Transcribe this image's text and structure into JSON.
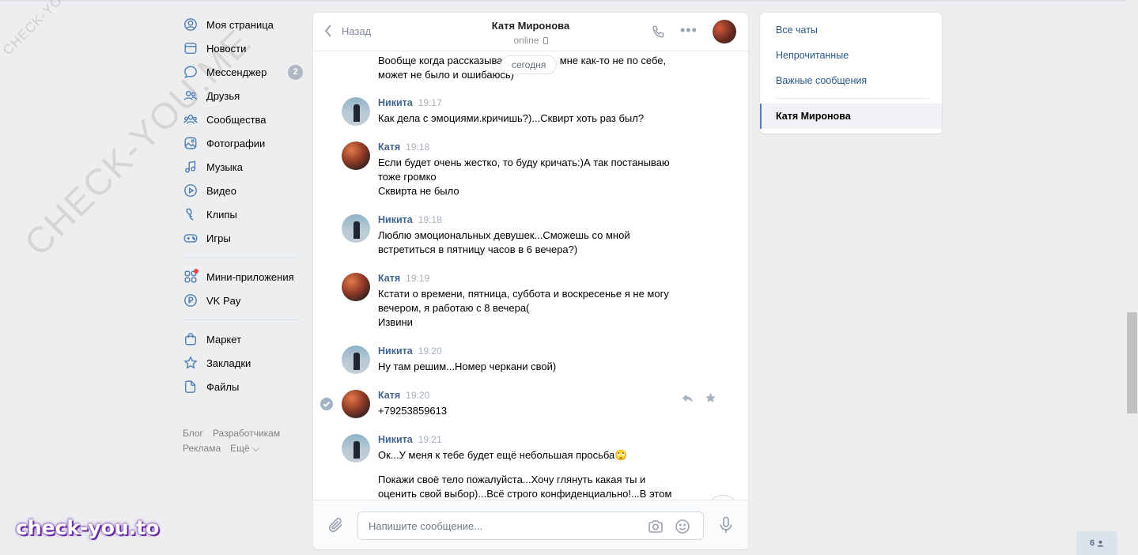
{
  "nav": {
    "items": [
      {
        "label": "Моя страница",
        "icon": "user-circle-icon"
      },
      {
        "label": "Новости",
        "icon": "news-icon"
      },
      {
        "label": "Мессенджер",
        "icon": "messenger-icon",
        "badge": "2"
      },
      {
        "label": "Друзья",
        "icon": "friends-icon"
      },
      {
        "label": "Сообщества",
        "icon": "communities-icon"
      },
      {
        "label": "Фотографии",
        "icon": "photos-icon"
      },
      {
        "label": "Музыка",
        "icon": "music-icon"
      },
      {
        "label": "Видео",
        "icon": "video-icon"
      },
      {
        "label": "Клипы",
        "icon": "clips-icon"
      },
      {
        "label": "Игры",
        "icon": "games-icon"
      }
    ],
    "items2": [
      {
        "label": "Мини-приложения",
        "icon": "mini-apps-icon"
      },
      {
        "label": "VK Pay",
        "icon": "vk-pay-icon"
      }
    ],
    "items3": [
      {
        "label": "Маркет",
        "icon": "market-icon"
      },
      {
        "label": "Закладки",
        "icon": "bookmarks-icon"
      },
      {
        "label": "Файлы",
        "icon": "files-icon"
      }
    ],
    "footer": {
      "blog": "Блог",
      "dev": "Разработчикам",
      "ads": "Реклама",
      "more": "Ещё ⌵"
    }
  },
  "chat": {
    "back_label": "Назад",
    "peer_name": "Катя Миронова",
    "peer_status": "online",
    "today_label": "сегодня",
    "input_placeholder": "Напишите сообщение...",
    "messages": [
      {
        "author": "",
        "time": "",
        "lines": [
          "Вообще когда рассказывала об этом, мне как-то не по себе,",
          "может не было и ошибаюсь)"
        ]
      },
      {
        "author": "Никита",
        "time": "19:17",
        "avatar": "nikita",
        "lines": [
          "Как дела с эмоциями.кричишь?)...Сквирт хоть раз был?"
        ]
      },
      {
        "author": "Катя",
        "time": "19:18",
        "avatar": "katya",
        "lines": [
          "Если будет очень жестко, то буду кричать:)А так постанываю",
          "тоже громко",
          "Сквирта не было"
        ]
      },
      {
        "author": "Никита",
        "time": "19:18",
        "avatar": "nikita",
        "lines": [
          "Люблю эмоциональных девушек...Сможешь со мной",
          "встретиться в пятницу часов в 6 вечера?)"
        ]
      },
      {
        "author": "Катя",
        "time": "19:19",
        "avatar": "katya",
        "lines": [
          "Кстати о времени, пятница, суббота и воскресенье я не могу",
          "вечером, я работаю с 8 вечера(",
          "Извини"
        ]
      },
      {
        "author": "Никита",
        "time": "19:20",
        "avatar": "nikita",
        "lines": [
          "Ну там решим...Номер черкани свой)"
        ]
      },
      {
        "author": "Катя",
        "time": "19:20",
        "avatar": "katya",
        "lines": [
          "+79253859613"
        ]
      },
      {
        "author": "Никита",
        "time": "19:21",
        "avatar": "nikita",
        "lines": [
          "Ок...У меня к тебе будет ещё небольшая просьба🙄",
          "",
          "Покажи своё тело пожалуйста...Хочу глянуть какая ты и",
          "оценить свой выбор)...Всё строго конфиденциально!...В этом"
        ]
      }
    ]
  },
  "right_panel": {
    "all_chats": "Все чаты",
    "unread": "Непрочитанные",
    "important": "Важные сообщения",
    "active_chat": "Катя Миронова"
  },
  "watermarks": {
    "small": "CHECK-YOU.ME",
    "big": "CHECK-YOU.ME",
    "bottom": "check-you.to"
  },
  "online_counter": "6",
  "colors": {
    "accent": "#5181b8",
    "author": "#42648b",
    "link": "#2a5885",
    "bg": "#edeef0"
  }
}
